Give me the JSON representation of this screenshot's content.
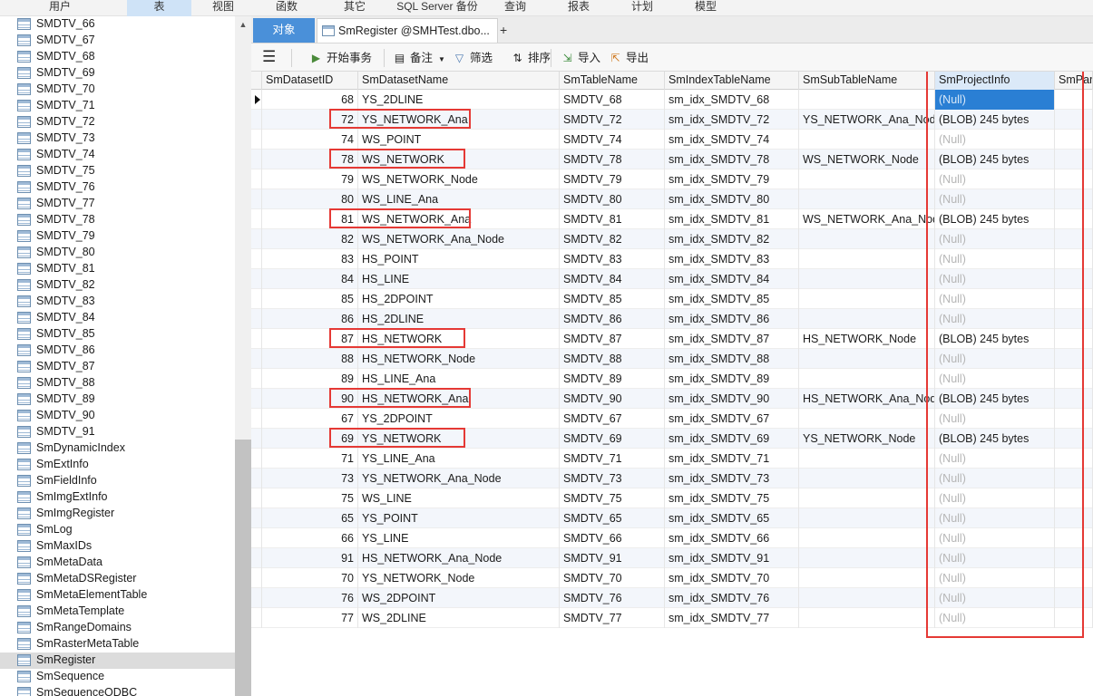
{
  "menu": [
    "用户",
    "表",
    "视图",
    "函数",
    "其它",
    "SQL Server 备份",
    "查询",
    "报表",
    "计划",
    "模型"
  ],
  "menu_active": "表",
  "tree": {
    "items": [
      "SMDTV_66",
      "SMDTV_67",
      "SMDTV_68",
      "SMDTV_69",
      "SMDTV_70",
      "SMDTV_71",
      "SMDTV_72",
      "SMDTV_73",
      "SMDTV_74",
      "SMDTV_75",
      "SMDTV_76",
      "SMDTV_77",
      "SMDTV_78",
      "SMDTV_79",
      "SMDTV_80",
      "SMDTV_81",
      "SMDTV_82",
      "SMDTV_83",
      "SMDTV_84",
      "SMDTV_85",
      "SMDTV_86",
      "SMDTV_87",
      "SMDTV_88",
      "SMDTV_89",
      "SMDTV_90",
      "SMDTV_91",
      "SmDynamicIndex",
      "SmExtInfo",
      "SmFieldInfo",
      "SmImgExtInfo",
      "SmImgRegister",
      "SmLog",
      "SmMaxIDs",
      "SmMetaData",
      "SmMetaDSRegister",
      "SmMetaElementTable",
      "SmMetaTemplate",
      "SmRangeDomains",
      "SmRasterMetaTable",
      "SmRegister",
      "SmSequence",
      "SmSequenceODBC"
    ],
    "selected": "SmRegister"
  },
  "tabs": {
    "objects": "对象",
    "smregister": "SmRegister @SMHTest.dbo...",
    "plus": "+"
  },
  "toolbar": {
    "menu_icon": "hamburger-icon",
    "begin_transaction": "开始事务",
    "note": "备注",
    "filter": "筛选",
    "sort": "排序",
    "import": "导入",
    "export": "导出"
  },
  "grid": {
    "columns": [
      "SmDatasetID",
      "SmDatasetName",
      "SmTableName",
      "SmIndexTableName",
      "SmSubTableName",
      "SmProjectInfo",
      "SmPare"
    ],
    "active_column": "SmProjectInfo",
    "rows": [
      [
        "68",
        "YS_2DLINE",
        "SMDTV_68",
        "sm_idx_SMDTV_68",
        "",
        "(Null)"
      ],
      [
        "72",
        "YS_NETWORK_Ana",
        "SMDTV_72",
        "sm_idx_SMDTV_72",
        "YS_NETWORK_Ana_Node",
        "(BLOB) 245 bytes"
      ],
      [
        "74",
        "WS_POINT",
        "SMDTV_74",
        "sm_idx_SMDTV_74",
        "",
        "(Null)"
      ],
      [
        "78",
        "WS_NETWORK",
        "SMDTV_78",
        "sm_idx_SMDTV_78",
        "WS_NETWORK_Node",
        "(BLOB) 245 bytes"
      ],
      [
        "79",
        "WS_NETWORK_Node",
        "SMDTV_79",
        "sm_idx_SMDTV_79",
        "",
        "(Null)"
      ],
      [
        "80",
        "WS_LINE_Ana",
        "SMDTV_80",
        "sm_idx_SMDTV_80",
        "",
        "(Null)"
      ],
      [
        "81",
        "WS_NETWORK_Ana",
        "SMDTV_81",
        "sm_idx_SMDTV_81",
        "WS_NETWORK_Ana_Node",
        "(BLOB) 245 bytes"
      ],
      [
        "82",
        "WS_NETWORK_Ana_Node",
        "SMDTV_82",
        "sm_idx_SMDTV_82",
        "",
        "(Null)"
      ],
      [
        "83",
        "HS_POINT",
        "SMDTV_83",
        "sm_idx_SMDTV_83",
        "",
        "(Null)"
      ],
      [
        "84",
        "HS_LINE",
        "SMDTV_84",
        "sm_idx_SMDTV_84",
        "",
        "(Null)"
      ],
      [
        "85",
        "HS_2DPOINT",
        "SMDTV_85",
        "sm_idx_SMDTV_85",
        "",
        "(Null)"
      ],
      [
        "86",
        "HS_2DLINE",
        "SMDTV_86",
        "sm_idx_SMDTV_86",
        "",
        "(Null)"
      ],
      [
        "87",
        "HS_NETWORK",
        "SMDTV_87",
        "sm_idx_SMDTV_87",
        "HS_NETWORK_Node",
        "(BLOB) 245 bytes"
      ],
      [
        "88",
        "HS_NETWORK_Node",
        "SMDTV_88",
        "sm_idx_SMDTV_88",
        "",
        "(Null)"
      ],
      [
        "89",
        "HS_LINE_Ana",
        "SMDTV_89",
        "sm_idx_SMDTV_89",
        "",
        "(Null)"
      ],
      [
        "90",
        "HS_NETWORK_Ana",
        "SMDTV_90",
        "sm_idx_SMDTV_90",
        "HS_NETWORK_Ana_Node",
        "(BLOB) 245 bytes"
      ],
      [
        "67",
        "YS_2DPOINT",
        "SMDTV_67",
        "sm_idx_SMDTV_67",
        "",
        "(Null)"
      ],
      [
        "69",
        "YS_NETWORK",
        "SMDTV_69",
        "sm_idx_SMDTV_69",
        "YS_NETWORK_Node",
        "(BLOB) 245 bytes"
      ],
      [
        "71",
        "YS_LINE_Ana",
        "SMDTV_71",
        "sm_idx_SMDTV_71",
        "",
        "(Null)"
      ],
      [
        "73",
        "YS_NETWORK_Ana_Node",
        "SMDTV_73",
        "sm_idx_SMDTV_73",
        "",
        "(Null)"
      ],
      [
        "75",
        "WS_LINE",
        "SMDTV_75",
        "sm_idx_SMDTV_75",
        "",
        "(Null)"
      ],
      [
        "65",
        "YS_POINT",
        "SMDTV_65",
        "sm_idx_SMDTV_65",
        "",
        "(Null)"
      ],
      [
        "66",
        "YS_LINE",
        "SMDTV_66",
        "sm_idx_SMDTV_66",
        "",
        "(Null)"
      ],
      [
        "91",
        "HS_NETWORK_Ana_Node",
        "SMDTV_91",
        "sm_idx_SMDTV_91",
        "",
        "(Null)"
      ],
      [
        "70",
        "YS_NETWORK_Node",
        "SMDTV_70",
        "sm_idx_SMDTV_70",
        "",
        "(Null)"
      ],
      [
        "76",
        "WS_2DPOINT",
        "SMDTV_76",
        "sm_idx_SMDTV_76",
        "",
        "(Null)"
      ],
      [
        "77",
        "WS_2DLINE",
        "SMDTV_77",
        "sm_idx_SMDTV_77",
        "",
        "(Null)"
      ]
    ],
    "current_row": "68",
    "highlighted_ids": [
      "72",
      "78",
      "81",
      "87",
      "90",
      "69"
    ]
  },
  "colors": {
    "annotation_red": "#e53935",
    "tab_active_blue": "#4a90d9",
    "selection_blue": "#2a7fd4"
  }
}
